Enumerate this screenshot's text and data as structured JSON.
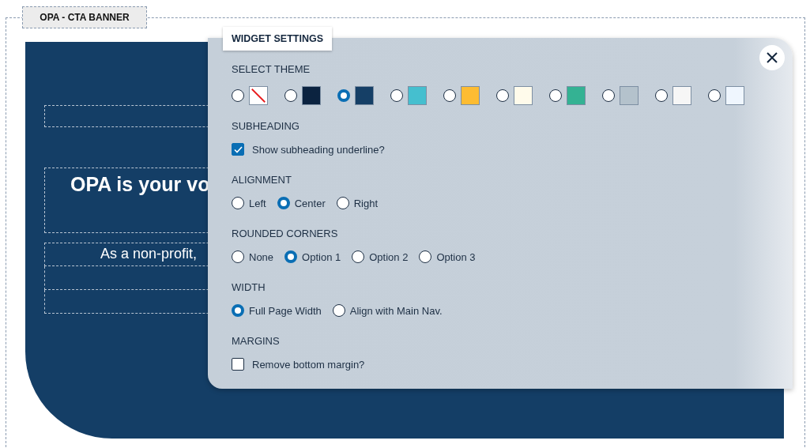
{
  "widget_label": "OPA - CTA BANNER",
  "banner": {
    "heading": "OPA is your vo",
    "body": "As a non-profit,"
  },
  "settings": {
    "title": "WIDGET SETTINGS",
    "sections": [
      {
        "kind": "swatches",
        "heading": "SELECT THEME",
        "options": [
          {
            "kind": "none",
            "selected": false
          },
          {
            "kind": "color",
            "color": "#0b2340",
            "selected": false
          },
          {
            "kind": "color",
            "color": "#153f66",
            "selected": true
          },
          {
            "kind": "color",
            "color": "#45bfcf",
            "selected": false
          },
          {
            "kind": "color",
            "color": "#fdbc32",
            "selected": false
          },
          {
            "kind": "color",
            "color": "#fffbeb",
            "selected": false
          },
          {
            "kind": "color",
            "color": "#34b293",
            "selected": false
          },
          {
            "kind": "color",
            "color": "#b4c2cc",
            "selected": false
          },
          {
            "kind": "color",
            "color": "#f6f6f6",
            "selected": false
          },
          {
            "kind": "color",
            "color": "#eff6fe",
            "selected": false
          }
        ]
      },
      {
        "kind": "checkbox",
        "heading": "SUBHEADING",
        "options": [
          {
            "label": "Show subheading underline?",
            "checked": true
          }
        ]
      },
      {
        "kind": "radio",
        "heading": "ALIGNMENT",
        "options": [
          {
            "label": "Left",
            "selected": false
          },
          {
            "label": "Center",
            "selected": true
          },
          {
            "label": "Right",
            "selected": false
          }
        ]
      },
      {
        "kind": "radio",
        "heading": "ROUNDED CORNERS",
        "options": [
          {
            "label": "None",
            "selected": false
          },
          {
            "label": "Option 1",
            "selected": true
          },
          {
            "label": "Option 2",
            "selected": false
          },
          {
            "label": "Option 3",
            "selected": false
          }
        ]
      },
      {
        "kind": "radio",
        "heading": "WIDTH",
        "options": [
          {
            "label": "Full Page Width",
            "selected": true
          },
          {
            "label": "Align with Main Nav.",
            "selected": false
          }
        ]
      },
      {
        "kind": "checkbox",
        "heading": "MARGINS",
        "options": [
          {
            "label": "Remove bottom margin?",
            "checked": false
          }
        ]
      }
    ]
  }
}
